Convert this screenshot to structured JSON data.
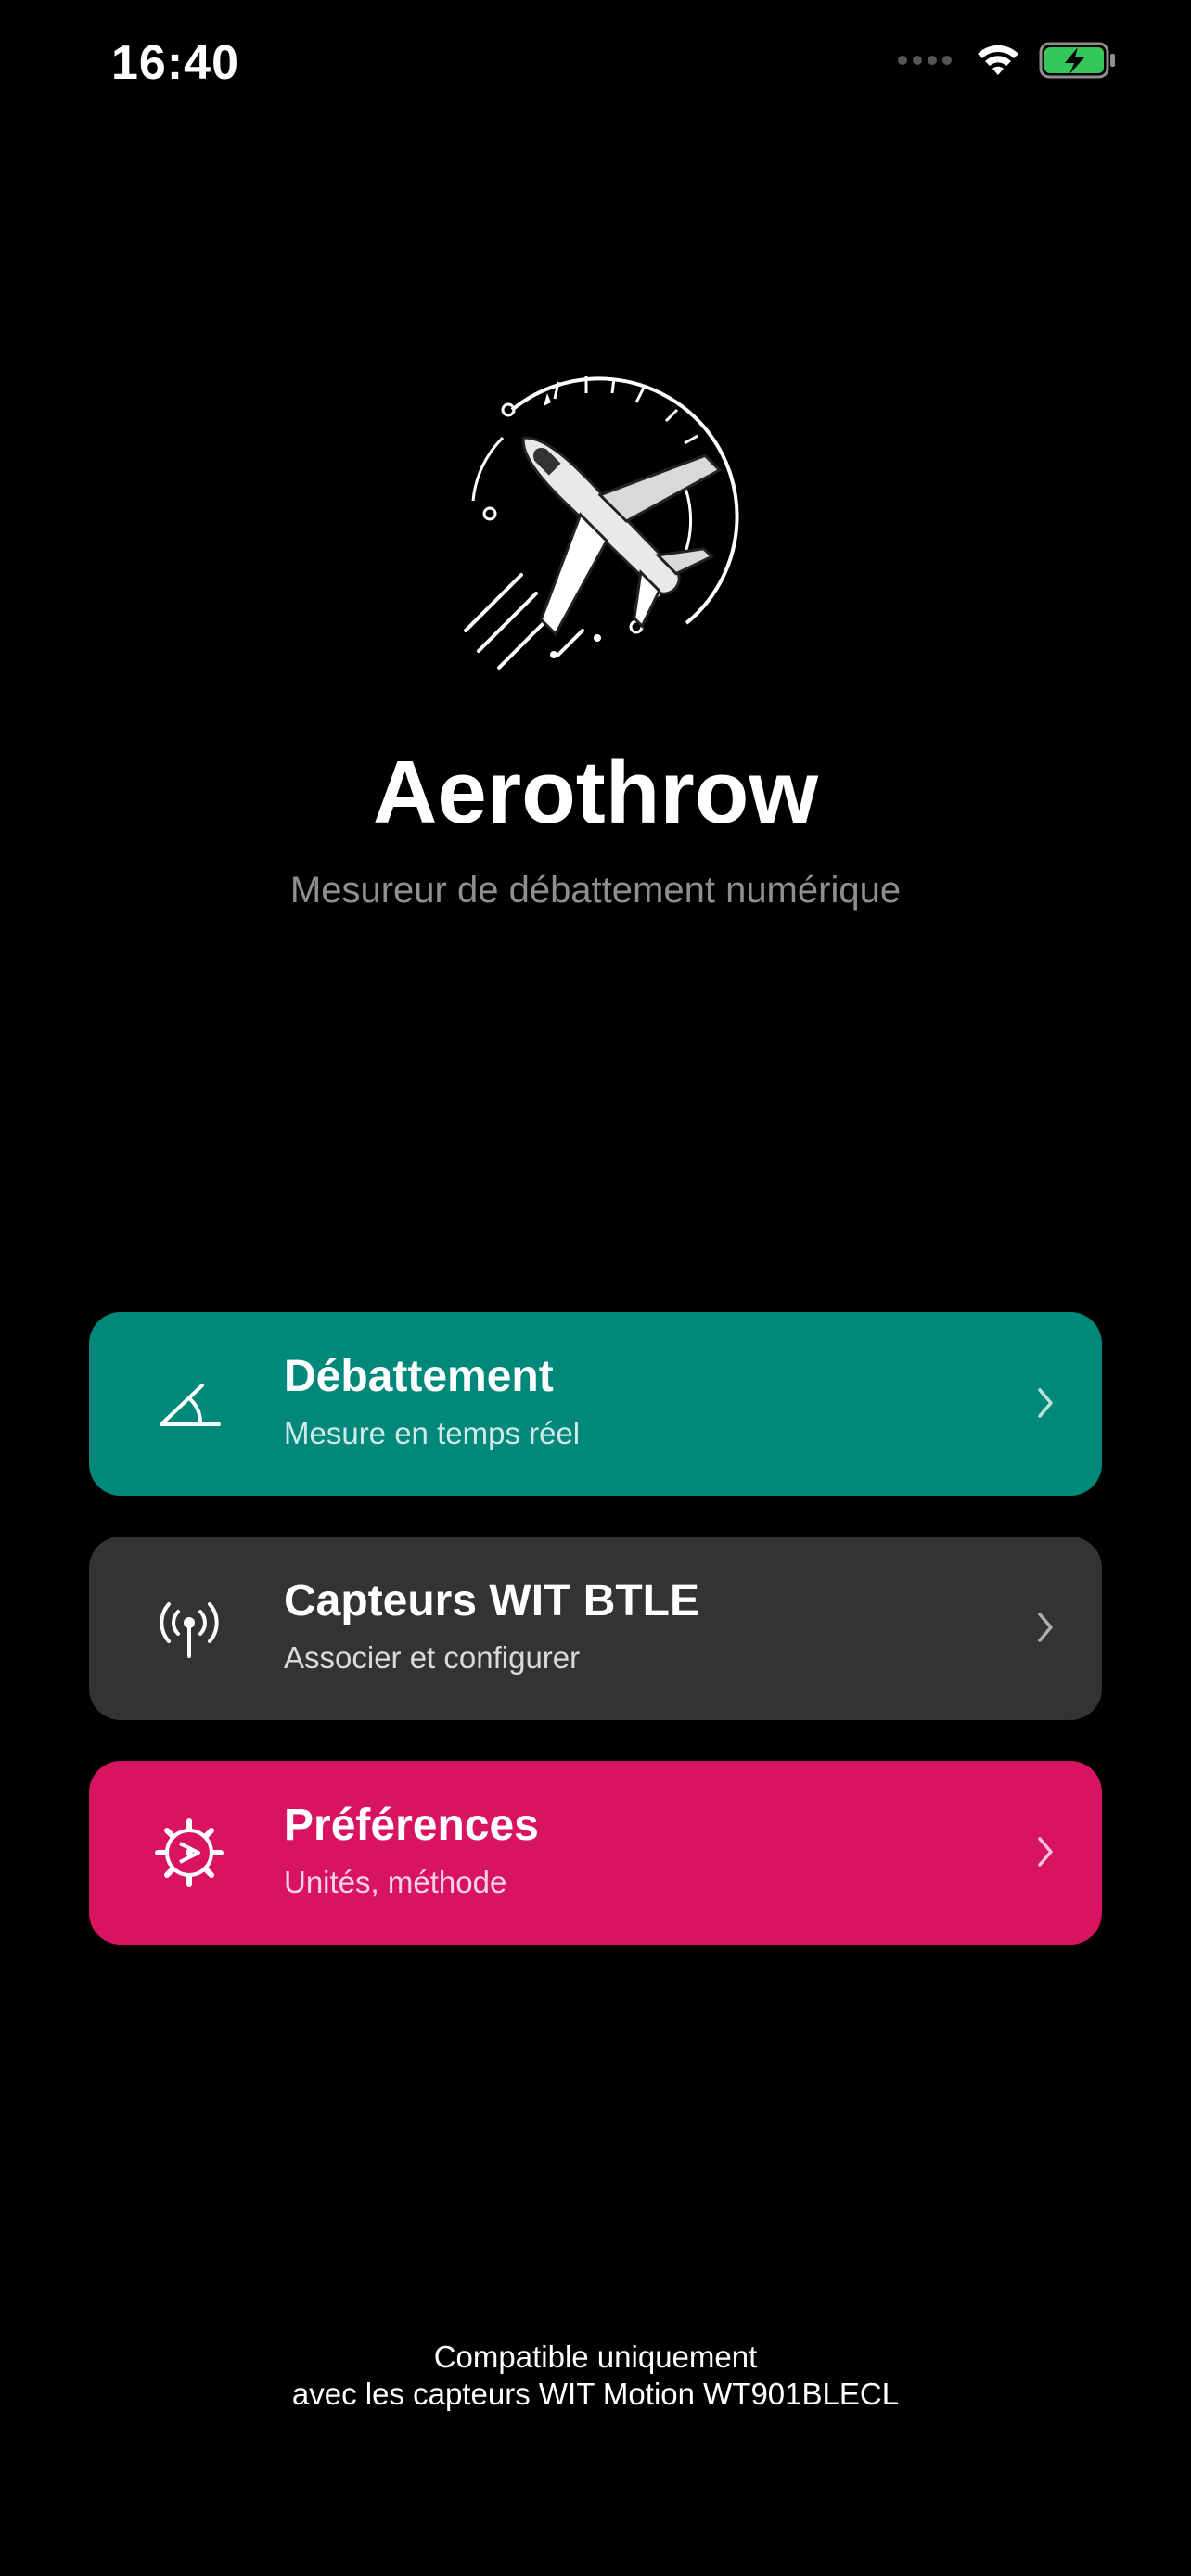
{
  "status_bar": {
    "time": "16:40"
  },
  "app": {
    "title": "Aerothrow",
    "subtitle": "Mesureur de débattement numérique"
  },
  "menu": [
    {
      "title": "Débattement",
      "subtitle": "Mesure en temps réel",
      "icon": "angle-icon",
      "color": "#00897b"
    },
    {
      "title": "Capteurs WIT BTLE",
      "subtitle": "Associer et configurer",
      "icon": "antenna-icon",
      "color": "#333335"
    },
    {
      "title": "Préférences",
      "subtitle": "Unités, méthode",
      "icon": "gear-icon",
      "color": "#d81462"
    }
  ],
  "footer": {
    "line1": "Compatible uniquement",
    "line2": "avec les capteurs WIT Motion WT901BLECL"
  }
}
